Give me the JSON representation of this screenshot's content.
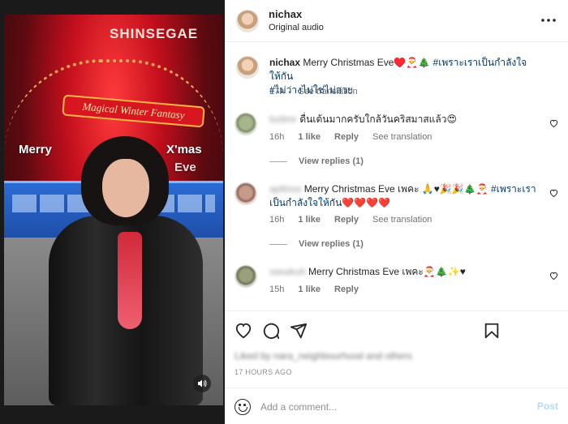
{
  "media": {
    "sign_text": "SHINSEGAE",
    "banner_text": "Magical Winter Fantasy",
    "overlay_left": "Merry",
    "overlay_right": "X'mas",
    "overlay_right2": "Eve",
    "sound_icon": "speaker-icon"
  },
  "header": {
    "username": "nichax",
    "subtitle": "Original audio",
    "more_icon": "more-horizontal-icon"
  },
  "caption": {
    "username": "nichax",
    "text": "Merry Christmas Eve♥️🎅🎄",
    "hashtag1": "#เพราะเราเป็นกำลังใจให้กัน",
    "hashtag2": "#ไม่ว่างไม่ใช่ไม่สวย",
    "time": "17h",
    "see_translation": "See translation"
  },
  "comments": [
    {
      "username": "bottmr",
      "text": "ดื่นเต้นมากครับใกล้วันคริสมาสแล้ว😍",
      "time": "16h",
      "likes": "1 like",
      "reply": "Reply",
      "see_translation": "See translation",
      "view_replies": "View replies (1)"
    },
    {
      "username": "aplilsss",
      "text": "Merry Christmas Eve เพคะ 🙏♥🎉🎉🎄🎅",
      "hashtag": "#เพราะเราเป็นกำลังใจให้กัน",
      "hearts": "❤️❤️❤️❤️",
      "time": "16h",
      "likes": "1 like",
      "reply": "Reply",
      "see_translation": "See translation",
      "view_replies": "View replies (1)"
    },
    {
      "username": "sasakuh",
      "text": "Merry Christmas Eve เพคะ🎅🎄✨♥",
      "time": "15h",
      "likes": "1 like",
      "reply": "Reply"
    }
  ],
  "actions": {
    "liked_by": "Liked by nara_neighbourhood and others",
    "timestamp": "17 HOURS AGO"
  },
  "composer": {
    "placeholder": "Add a comment...",
    "post_label": "Post"
  }
}
